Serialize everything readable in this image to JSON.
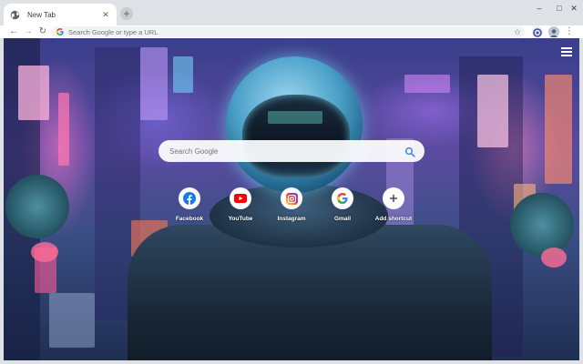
{
  "browser": {
    "tab": {
      "title": "New Tab",
      "close_glyph": "✕"
    },
    "new_tab_glyph": "+",
    "window_controls": {
      "minimize": "–",
      "maximize": "□",
      "close": "✕"
    },
    "nav": {
      "back": "←",
      "forward": "→",
      "reload": "↻"
    },
    "omnibox": {
      "placeholder": "Search Google or type a URL",
      "value": "",
      "star": "☆"
    },
    "menu_glyph": "⋮"
  },
  "newtab": {
    "search": {
      "placeholder": "Search Google",
      "value": ""
    },
    "shortcuts": [
      {
        "label": "Facebook",
        "icon": "facebook-icon",
        "color": "#1877f2"
      },
      {
        "label": "YouTube",
        "icon": "youtube-icon",
        "color": "#ff0000"
      },
      {
        "label": "Instagram",
        "icon": "instagram-icon",
        "color": "#c13584"
      },
      {
        "label": "Gmail",
        "icon": "google-g-icon",
        "color": "#4285f4"
      },
      {
        "label": "Add shortcut",
        "icon": "plus-icon",
        "color": "#3c4043"
      }
    ]
  }
}
